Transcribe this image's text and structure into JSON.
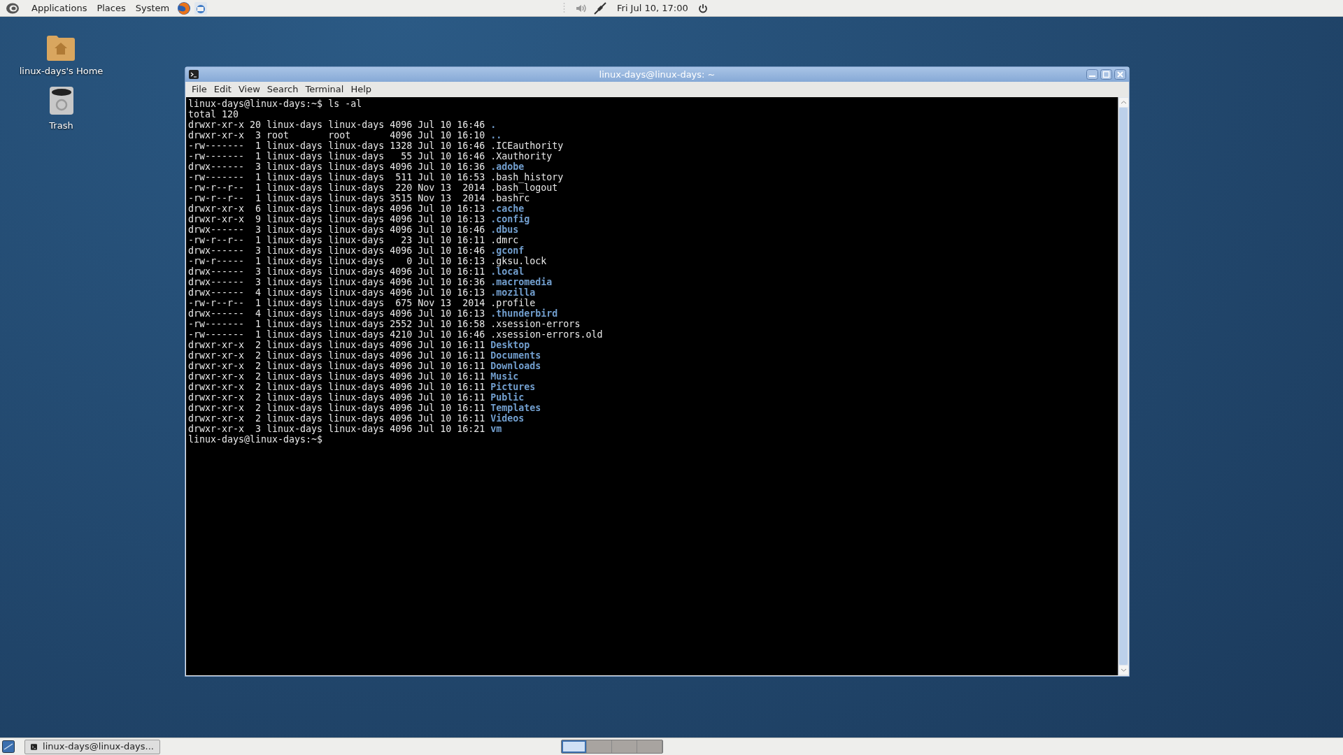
{
  "top_panel": {
    "menus": [
      "Applications",
      "Places",
      "System"
    ],
    "clock": "Fri Jul 10, 17:00"
  },
  "desktop_icons": [
    {
      "label": "linux-days's Home",
      "kind": "home"
    },
    {
      "label": "Trash",
      "kind": "trash"
    }
  ],
  "window": {
    "title": "linux-days@linux-days: ~",
    "menu": [
      "File",
      "Edit",
      "View",
      "Search",
      "Terminal",
      "Help"
    ],
    "lines": [
      {
        "kind": "text",
        "text": "linux-days@linux-days:~$ ls -al"
      },
      {
        "kind": "text",
        "text": "total 120"
      },
      {
        "kind": "entry",
        "meta": "drwxr-xr-x 20 linux-days linux-days 4096 Jul 10 16:46",
        "name": ".",
        "dir": true
      },
      {
        "kind": "entry",
        "meta": "drwxr-xr-x  3 root       root       4096 Jul 10 16:10",
        "name": "..",
        "dir": true
      },
      {
        "kind": "entry",
        "meta": "-rw-------  1 linux-days linux-days 1328 Jul 10 16:46",
        "name": ".ICEauthority",
        "dir": false
      },
      {
        "kind": "entry",
        "meta": "-rw-------  1 linux-days linux-days   55 Jul 10 16:46",
        "name": ".Xauthority",
        "dir": false
      },
      {
        "kind": "entry",
        "meta": "drwx------  3 linux-days linux-days 4096 Jul 10 16:36",
        "name": ".adobe",
        "dir": true
      },
      {
        "kind": "entry",
        "meta": "-rw-------  1 linux-days linux-days  511 Jul 10 16:53",
        "name": ".bash_history",
        "dir": false
      },
      {
        "kind": "entry",
        "meta": "-rw-r--r--  1 linux-days linux-days  220 Nov 13  2014",
        "name": ".bash_logout",
        "dir": false
      },
      {
        "kind": "entry",
        "meta": "-rw-r--r--  1 linux-days linux-days 3515 Nov 13  2014",
        "name": ".bashrc",
        "dir": false
      },
      {
        "kind": "entry",
        "meta": "drwxr-xr-x  6 linux-days linux-days 4096 Jul 10 16:13",
        "name": ".cache",
        "dir": true
      },
      {
        "kind": "entry",
        "meta": "drwxr-xr-x  9 linux-days linux-days 4096 Jul 10 16:13",
        "name": ".config",
        "dir": true
      },
      {
        "kind": "entry",
        "meta": "drwx------  3 linux-days linux-days 4096 Jul 10 16:46",
        "name": ".dbus",
        "dir": true
      },
      {
        "kind": "entry",
        "meta": "-rw-r--r--  1 linux-days linux-days   23 Jul 10 16:11",
        "name": ".dmrc",
        "dir": false
      },
      {
        "kind": "entry",
        "meta": "drwx------  3 linux-days linux-days 4096 Jul 10 16:46",
        "name": ".gconf",
        "dir": true
      },
      {
        "kind": "entry",
        "meta": "-rw-r-----  1 linux-days linux-days    0 Jul 10 16:13",
        "name": ".gksu.lock",
        "dir": false
      },
      {
        "kind": "entry",
        "meta": "drwx------  3 linux-days linux-days 4096 Jul 10 16:11",
        "name": ".local",
        "dir": true
      },
      {
        "kind": "entry",
        "meta": "drwx------  3 linux-days linux-days 4096 Jul 10 16:36",
        "name": ".macromedia",
        "dir": true
      },
      {
        "kind": "entry",
        "meta": "drwx------  4 linux-days linux-days 4096 Jul 10 16:13",
        "name": ".mozilla",
        "dir": true
      },
      {
        "kind": "entry",
        "meta": "-rw-r--r--  1 linux-days linux-days  675 Nov 13  2014",
        "name": ".profile",
        "dir": false
      },
      {
        "kind": "entry",
        "meta": "drwx------  4 linux-days linux-days 4096 Jul 10 16:13",
        "name": ".thunderbird",
        "dir": true
      },
      {
        "kind": "entry",
        "meta": "-rw-------  1 linux-days linux-days 2552 Jul 10 16:58",
        "name": ".xsession-errors",
        "dir": false
      },
      {
        "kind": "entry",
        "meta": "-rw-------  1 linux-days linux-days 4210 Jul 10 16:46",
        "name": ".xsession-errors.old",
        "dir": false
      },
      {
        "kind": "entry",
        "meta": "drwxr-xr-x  2 linux-days linux-days 4096 Jul 10 16:11",
        "name": "Desktop",
        "dir": true
      },
      {
        "kind": "entry",
        "meta": "drwxr-xr-x  2 linux-days linux-days 4096 Jul 10 16:11",
        "name": "Documents",
        "dir": true
      },
      {
        "kind": "entry",
        "meta": "drwxr-xr-x  2 linux-days linux-days 4096 Jul 10 16:11",
        "name": "Downloads",
        "dir": true
      },
      {
        "kind": "entry",
        "meta": "drwxr-xr-x  2 linux-days linux-days 4096 Jul 10 16:11",
        "name": "Music",
        "dir": true
      },
      {
        "kind": "entry",
        "meta": "drwxr-xr-x  2 linux-days linux-days 4096 Jul 10 16:11",
        "name": "Pictures",
        "dir": true
      },
      {
        "kind": "entry",
        "meta": "drwxr-xr-x  2 linux-days linux-days 4096 Jul 10 16:11",
        "name": "Public",
        "dir": true
      },
      {
        "kind": "entry",
        "meta": "drwxr-xr-x  2 linux-days linux-days 4096 Jul 10 16:11",
        "name": "Templates",
        "dir": true
      },
      {
        "kind": "entry",
        "meta": "drwxr-xr-x  2 linux-days linux-days 4096 Jul 10 16:11",
        "name": "Videos",
        "dir": true
      },
      {
        "kind": "entry",
        "meta": "drwxr-xr-x  3 linux-days linux-days 4096 Jul 10 16:21",
        "name": "vm",
        "dir": true
      },
      {
        "kind": "text",
        "text": "linux-days@linux-days:~$"
      }
    ]
  },
  "taskbar": {
    "tasks": [
      {
        "label": "linux-days@linux-days...",
        "selected": false
      }
    ],
    "workspaces": [
      {
        "selected": true
      },
      {
        "selected": false
      },
      {
        "selected": false
      },
      {
        "selected": false
      }
    ]
  }
}
